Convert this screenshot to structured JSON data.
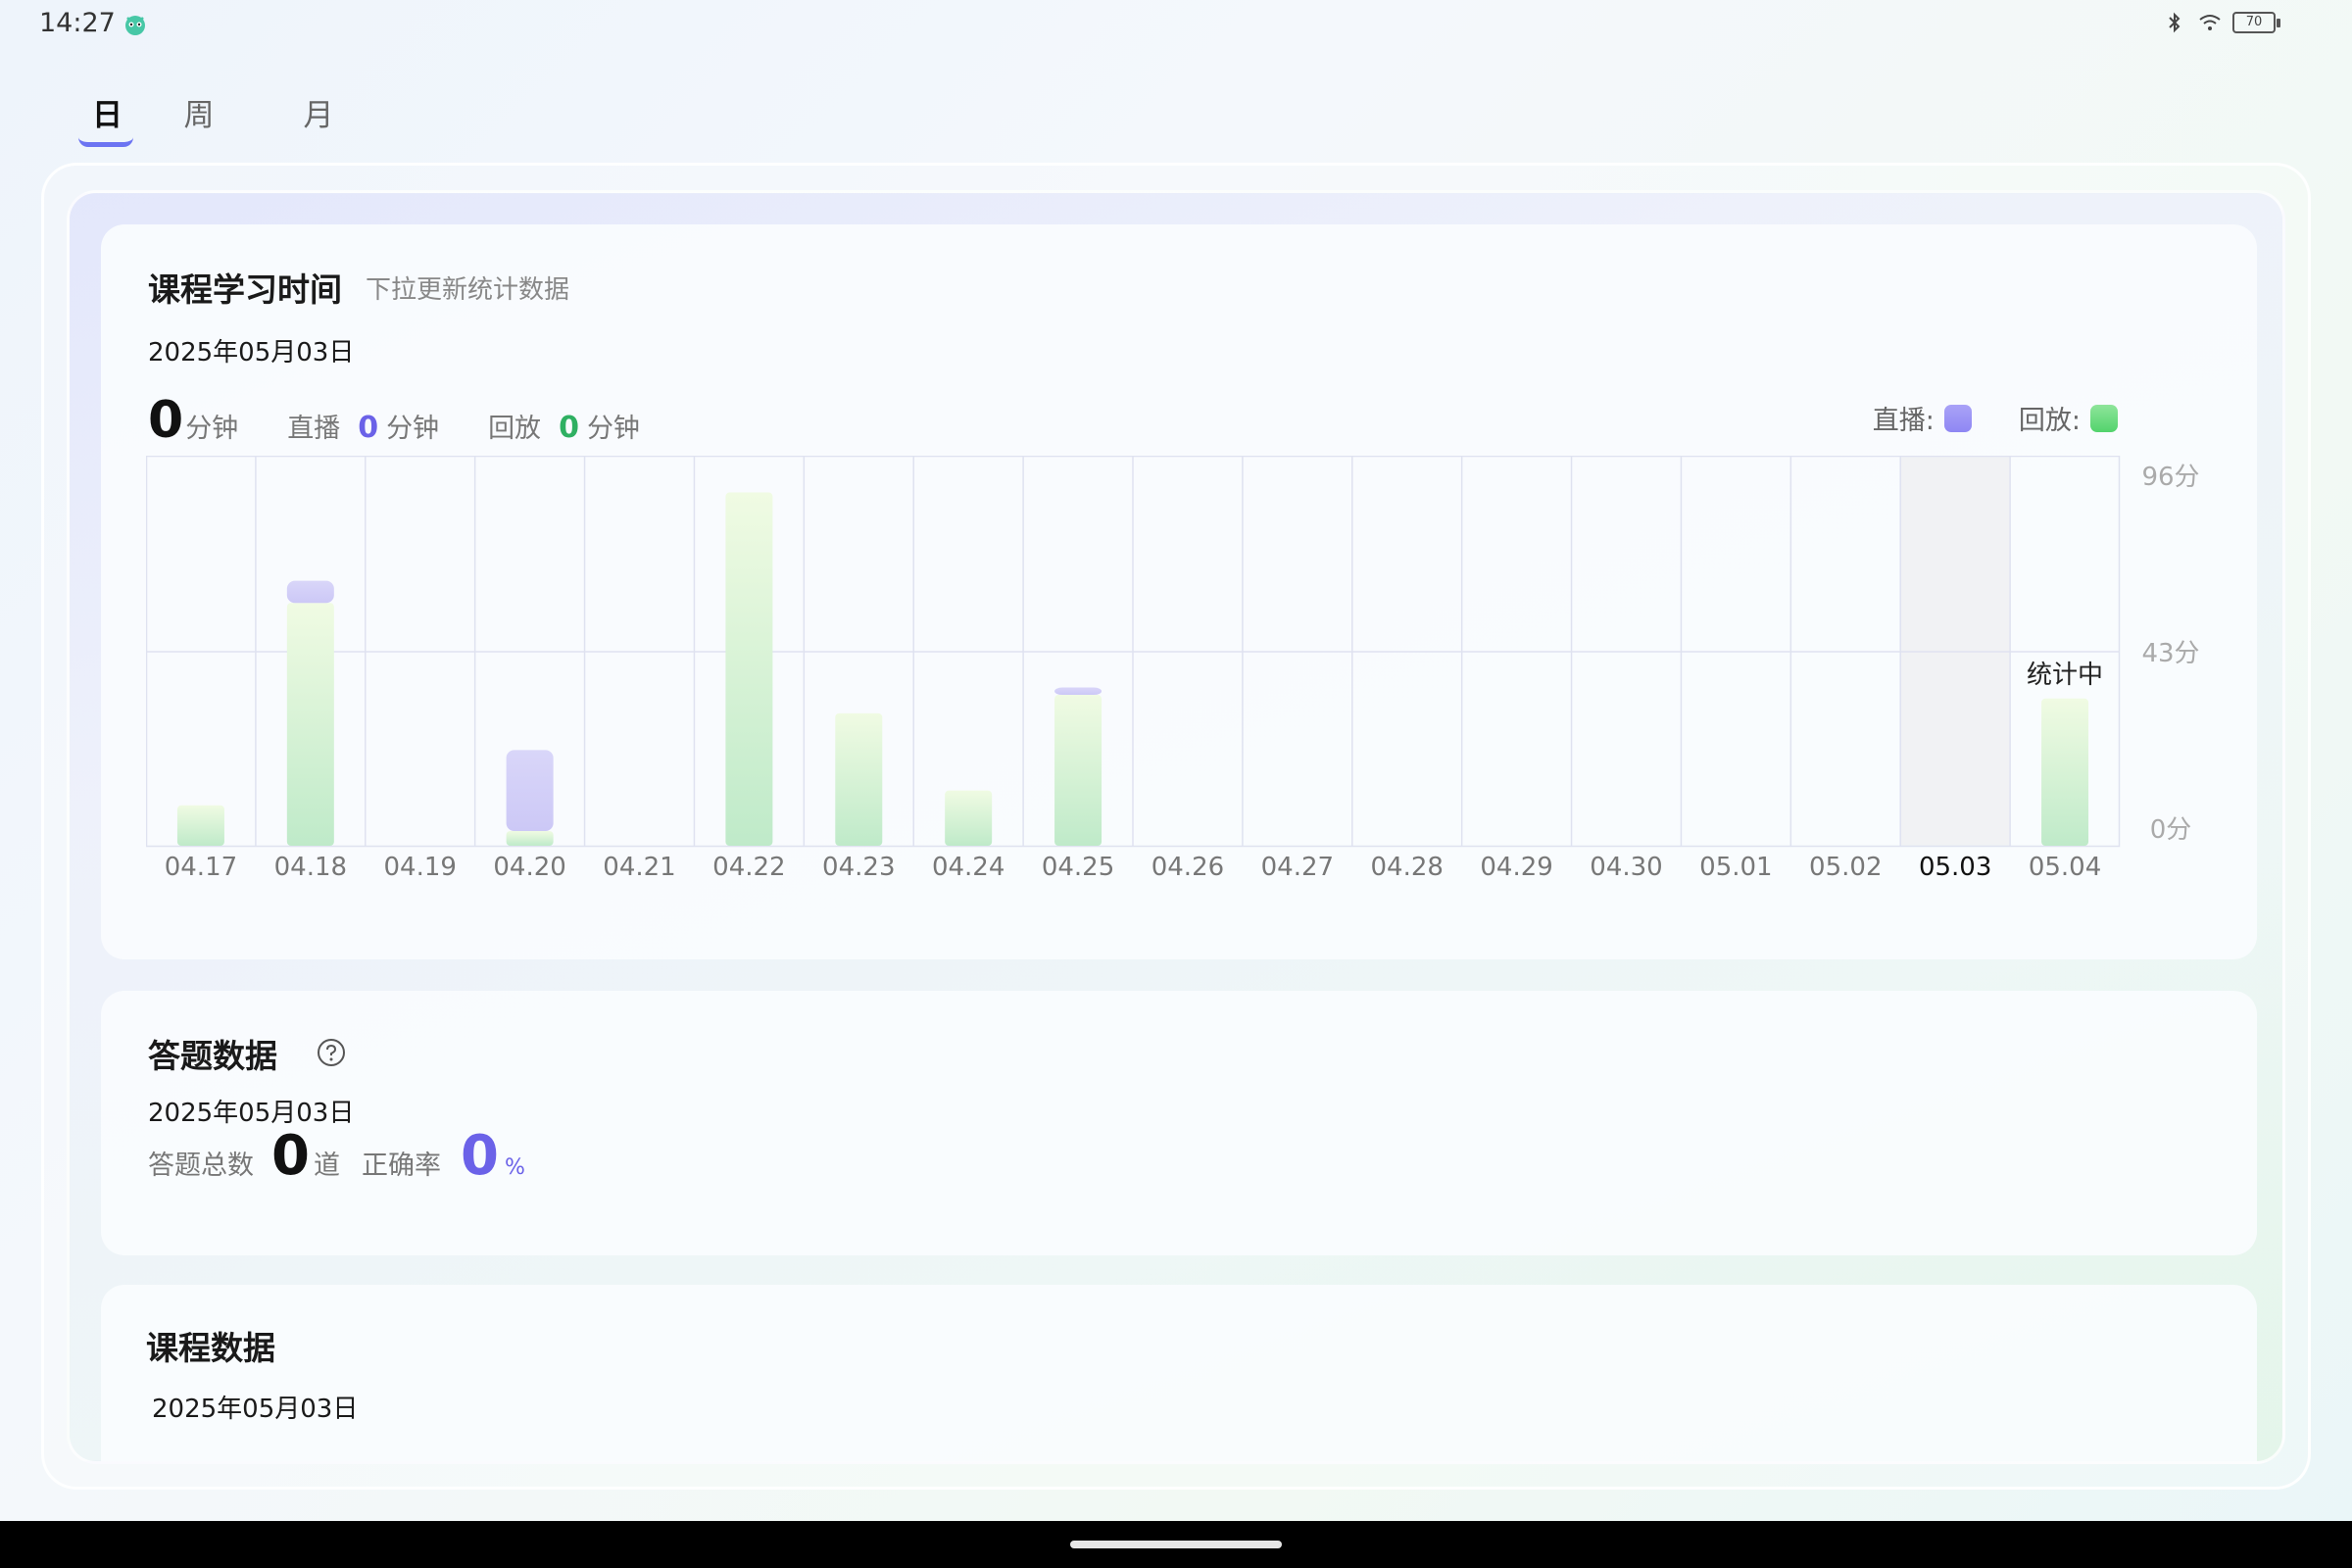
{
  "status_bar": {
    "time": "14:27",
    "app_icon": "robot-app-icon",
    "icons": [
      "bluetooth-icon",
      "wifi-icon"
    ],
    "battery": "70"
  },
  "tabs": [
    {
      "label": "日",
      "active": true
    },
    {
      "label": "周",
      "active": false
    },
    {
      "label": "月",
      "active": false
    }
  ],
  "study_time": {
    "title": "课程学习时间",
    "subtitle": "下拉更新统计数据",
    "date": "2025年05月03日",
    "total": "0",
    "total_unit": "分钟",
    "live_label": "直播",
    "live_value": "0",
    "live_unit": "分钟",
    "playback_label": "回放",
    "playback_value": "0",
    "playback_unit": "分钟",
    "legend_live": "直播:",
    "legend_playback": "回放:",
    "colors": {
      "live": "#8f87f3",
      "playback": "#52d36c"
    }
  },
  "chart_data": {
    "type": "bar",
    "stacked": true,
    "categories": [
      "04.17",
      "04.18",
      "04.19",
      "04.20",
      "04.21",
      "04.22",
      "04.23",
      "04.24",
      "04.25",
      "04.26",
      "04.27",
      "04.28",
      "04.29",
      "04.30",
      "05.01",
      "05.02",
      "05.03",
      "05.04"
    ],
    "series": [
      {
        "name": "回放",
        "values": [
          11,
          66,
          0,
          4,
          0,
          96,
          36,
          15,
          41,
          0,
          0,
          0,
          0,
          0,
          0,
          0,
          0,
          40
        ]
      },
      {
        "name": "直播",
        "values": [
          0,
          6,
          0,
          22,
          0,
          0,
          0,
          0,
          2,
          0,
          0,
          0,
          0,
          0,
          0,
          0,
          0,
          0
        ]
      }
    ],
    "y_ticks": [
      "96分",
      "43分",
      "0分"
    ],
    "ylim": [
      0,
      106
    ],
    "selected_category": "05.03",
    "bar_annotation": {
      "category": "05.04",
      "text": "统计中"
    },
    "grid": true
  },
  "answers": {
    "title": "答题数据",
    "help_icon": "question-circle-icon",
    "date": "2025年05月03日",
    "total_label": "答题总数",
    "total_value": "0",
    "total_unit": "道",
    "accuracy_label": "正确率",
    "accuracy_value": "0",
    "accuracy_unit": "%"
  },
  "course": {
    "title": "课程数据",
    "date": "2025年05月03日"
  }
}
